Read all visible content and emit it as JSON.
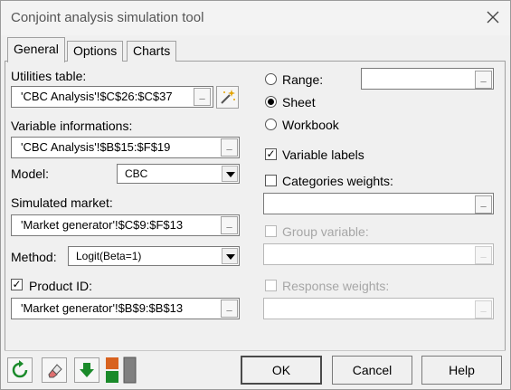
{
  "window": {
    "title": "Conjoint analysis simulation tool"
  },
  "tabs": [
    {
      "label": "General"
    },
    {
      "label": "Options"
    },
    {
      "label": "Charts"
    }
  ],
  "left": {
    "utilities_label": "Utilities table:",
    "utilities_value": "'CBC Analysis'!$C$26:$C$37",
    "variable_label": "Variable informations:",
    "variable_value": "'CBC Analysis'!$B$15:$F$19",
    "model_label": "Model:",
    "model_value": "CBC",
    "market_label": "Simulated market:",
    "market_value": "'Market generator'!$C$9:$F$13",
    "method_label": "Method:",
    "method_value": "Logit(Beta=1)",
    "product_id_label": "Product ID:",
    "product_id_value": "'Market generator'!$B$9:$B$13",
    "ref_btn_glyph": "_"
  },
  "right": {
    "range_label": "Range:",
    "sheet_label": "Sheet",
    "workbook_label": "Workbook",
    "variable_labels_label": "Variable labels",
    "categories_weights_label": "Categories weights:",
    "group_variable_label": "Group variable:",
    "response_weights_label": "Response weights:",
    "selected_range_option": "Sheet",
    "check_mark": "✓"
  },
  "buttons": {
    "ok": "OK",
    "cancel": "Cancel",
    "help": "Help"
  },
  "colors": {
    "green_icon": "#1a8a2a",
    "orange_icon": "#d8621f",
    "grey_icon": "#808080"
  }
}
